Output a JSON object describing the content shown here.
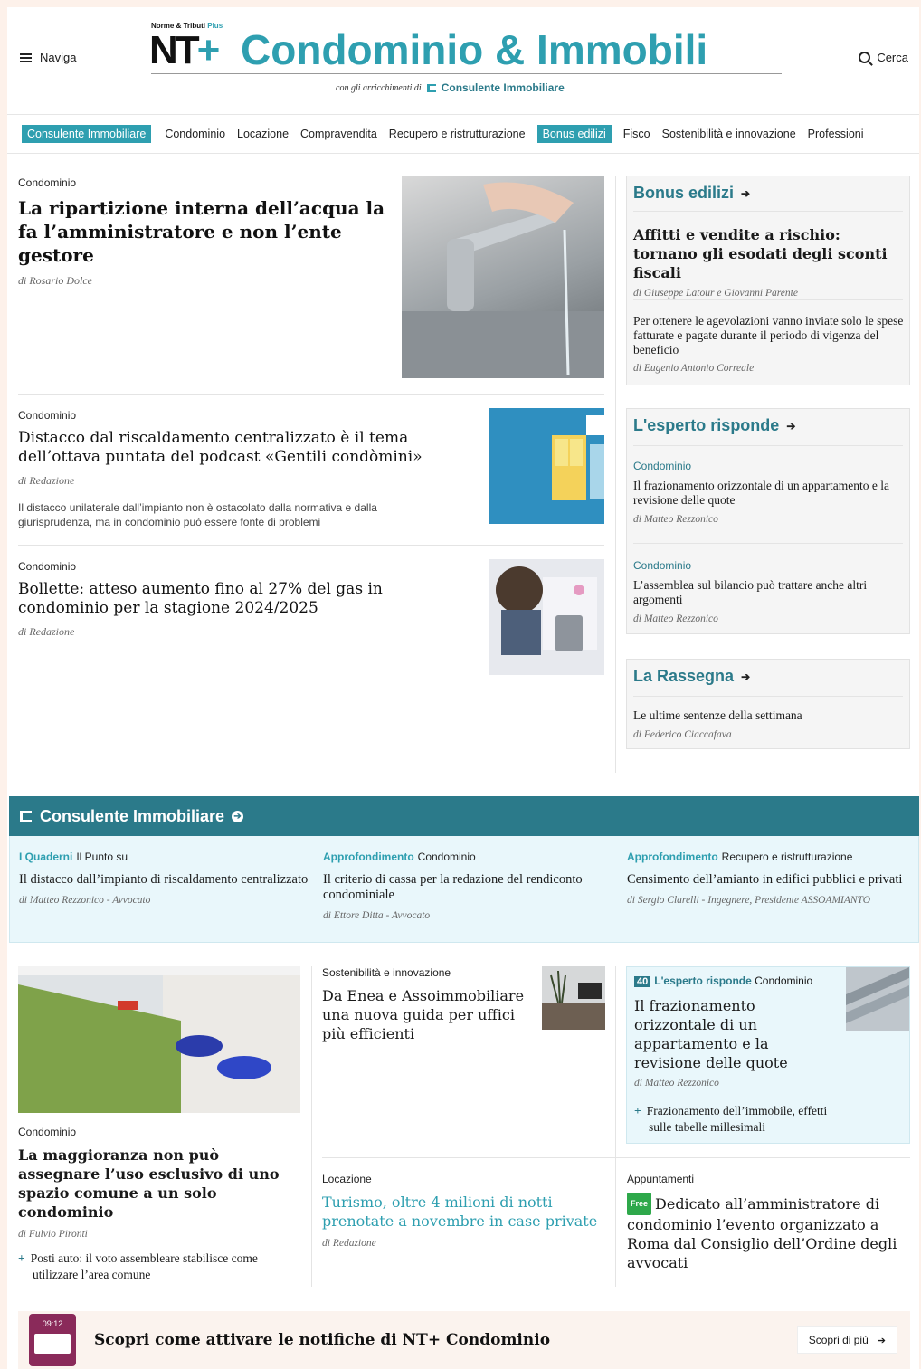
{
  "header": {
    "menu_label": "Naviga",
    "search_label": "Cerca",
    "brand_top": "Norme & Tributi",
    "brand_top_plus": "Plus",
    "logo_nt": "NT",
    "logo_plus": "+",
    "logo_title": "Condominio & Immobili",
    "sub_brand_prefix": "con gli arricchimenti di",
    "sub_brand_name": "Consulente Immobiliare"
  },
  "nav": [
    {
      "label": "Consulente Immobiliare",
      "highlight": true
    },
    {
      "label": "Condominio",
      "highlight": false
    },
    {
      "label": "Locazione",
      "highlight": false
    },
    {
      "label": "Compravendita",
      "highlight": false
    },
    {
      "label": "Recupero e ristrutturazione",
      "highlight": false
    },
    {
      "label": "Bonus edilizi",
      "highlight": true
    },
    {
      "label": "Fisco",
      "highlight": false
    },
    {
      "label": "Sostenibilità e innovazione",
      "highlight": false
    },
    {
      "label": "Professioni",
      "highlight": false
    }
  ],
  "lead": [
    {
      "kicker": "Condominio",
      "title": "La ripartizione interna dell’acqua la fa l’amministratore e non l’ente gestore",
      "author": "di Rosario Dolce"
    },
    {
      "kicker": "Condominio",
      "title": "Distacco dal riscaldamento centralizzato è il tema dell’ottava puntata del podcast «Gentili condòmini»",
      "author": "di Redazione",
      "excerpt": "Il distacco unilaterale dall’impianto non è ostacolato dalla normativa e dalla giurisprudenza, ma in condominio può essere fonte di problemi"
    },
    {
      "kicker": "Condominio",
      "title": "Bollette: atteso aumento fino al 27% del gas in condominio per la stagione 2024/2025",
      "author": "di Redazione"
    }
  ],
  "sidebar": {
    "bonus": {
      "title": "Bonus edilizi",
      "items": [
        {
          "title": "Affitti e vendite a rischio: tornano gli esodati degli sconti fiscali",
          "author": "di Giuseppe Latour e Giovanni Parente"
        },
        {
          "title": "Per ottenere le agevolazioni vanno inviate solo le spese fatturate e pagate durante il periodo di vigenza del beneficio",
          "author": "di Eugenio Antonio Correale"
        }
      ]
    },
    "esperto": {
      "title": "L'esperto risponde",
      "items": [
        {
          "kicker": "Condominio",
          "title": "Il frazionamento orizzontale di un appartamento e la revisione delle quote",
          "author": "di Matteo Rezzonico"
        },
        {
          "kicker": "Condominio",
          "title": "L’assemblea sul bilancio può trattare anche altri argomenti",
          "author": "di Matteo Rezzonico"
        }
      ]
    },
    "rassegna": {
      "title": "La Rassegna",
      "items": [
        {
          "title": "Le ultime sentenze della settimana",
          "author": "di Federico Ciaccafava"
        }
      ]
    }
  },
  "consulente": {
    "title": "Consulente Immobiliare",
    "cols": [
      {
        "k1": "I Quaderni",
        "k2": "Il Punto su",
        "title": "Il distacco dall’impianto di riscaldamento centralizzato",
        "author": "di Matteo Rezzonico - Avvocato"
      },
      {
        "k1": "Approfondimento",
        "k2": "Condominio",
        "title": "Il criterio di cassa per la redazione del rendiconto condominiale",
        "author": "di Ettore Ditta - Avvocato"
      },
      {
        "k1": "Approfondimento",
        "k2": "Recupero e ristrutturazione",
        "title": "Censimento dell’amianto in edifici pubblici e privati",
        "author": "di Sergio Clarelli - Ingegnere, Presidente ASSOAMIANTO"
      }
    ]
  },
  "lower": {
    "left": {
      "kicker": "Condominio",
      "title": "La maggioranza non può assegnare l’uso esclusivo di uno spazio comune a un solo condominio",
      "author": "di Fulvio Pironti",
      "related": "Posti auto: il voto assembleare stabilisce come utilizzare l’area comune"
    },
    "middle_top": {
      "kicker": "Sostenibilità e innovazione",
      "title": "Da Enea e Assoimmobiliare una nuova guida per uffici più efficienti"
    },
    "middle_bottom": {
      "kicker": "Locazione",
      "title": "Turismo, oltre 4 milioni di notti prenotate a novembre in case private",
      "author": "di Redazione"
    },
    "right_top": {
      "badge": "40",
      "k1": "L'esperto risponde",
      "k2": "Condominio",
      "title": "Il frazionamento orizzontale di un appartamento e la revisione delle quote",
      "author": "di Matteo Rezzonico",
      "related": "Frazionamento dell’immobile, effetti sulle tabelle millesimali"
    },
    "right_bottom": {
      "kicker": "Appuntamenti",
      "badge": "Free",
      "title": "Dedicato all’amministratore di condominio l’evento organizzato a Roma dal Consiglio dell’Ordine degli avvocati"
    }
  },
  "notification": {
    "phone_time": "09:12",
    "title": "Scopri come attivare le notifiche di NT+ Condominio",
    "button": "Scopri di più"
  },
  "colors": {
    "teal": "#2e9fb0",
    "teal_dark": "#2b7a8a",
    "consulente_bg": "#e9f7fb",
    "free_green": "#2ea84a"
  }
}
